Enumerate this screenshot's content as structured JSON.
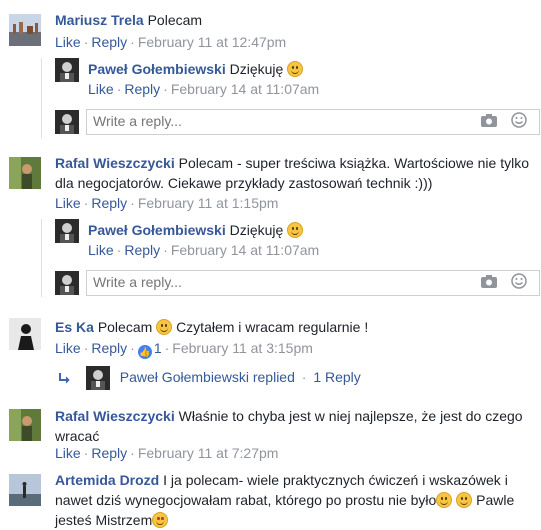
{
  "comments": [
    {
      "author": "Mariusz Trela",
      "text": "Polecam",
      "like": "Like",
      "reply": "Reply",
      "time": "February 11 at 12:47pm",
      "replies": [
        {
          "author": "Paweł Gołembiewski",
          "text": "Dziękuję",
          "emoji": "smile-emoji",
          "like": "Like",
          "reply": "Reply",
          "time": "February 14 at 11:07am"
        }
      ],
      "reply_placeholder": "Write a reply..."
    },
    {
      "author": "Rafal Wieszczycki",
      "text_line1": "Polecam - super treściwa książka. Wartościowe nie tylko",
      "text_line2": "dla negocjatorów. Ciekawe przykłady zastosowań technik :)))",
      "like": "Like",
      "reply": "Reply",
      "time": "February 11 at 1:15pm",
      "replies": [
        {
          "author": "Paweł Gołembiewski",
          "text": "Dziękuję",
          "emoji": "smile-emoji",
          "like": "Like",
          "reply": "Reply",
          "time": "February 14 at 11:07am"
        }
      ],
      "reply_placeholder": "Write a reply..."
    },
    {
      "author": "Es Ka",
      "text_before": "Polecam",
      "text_after": "Czytałem i wracam regularnie !",
      "like": "Like",
      "reply": "Reply",
      "reaction_count": "1",
      "time": "February 11 at 3:15pm",
      "replied_summary": {
        "author": "Paweł Gołembiewski",
        "label": "replied",
        "count_label": "1 Reply"
      }
    },
    {
      "author": "Rafal Wieszczycki",
      "text_line1": "Właśnie to chyba jest w niej najlepsze, że jest do czego",
      "text_line2": "wracać",
      "like": "Like",
      "reply": "Reply",
      "time": "February 11 at 7:27pm"
    },
    {
      "author": "Artemida Drozd",
      "text_line1": "I ja polecam- wiele praktycznych ćwiczeń i wskazówek i",
      "text_line2": "nawet dziś wynegocjowałam rabat, którego po prostu nie było",
      "text_line2b": "Pawle",
      "text_line3": "jesteś Mistrzem"
    }
  ],
  "separator": "·",
  "icons": {
    "camera": "camera-icon",
    "emoji_picker": "emoji-picker-icon",
    "reply_arrow": "reply-arrow-icon",
    "like_reaction": "like-reaction-icon"
  },
  "colors": {
    "link": "#365899",
    "meta": "#90949c",
    "border": "#dddfe2"
  }
}
